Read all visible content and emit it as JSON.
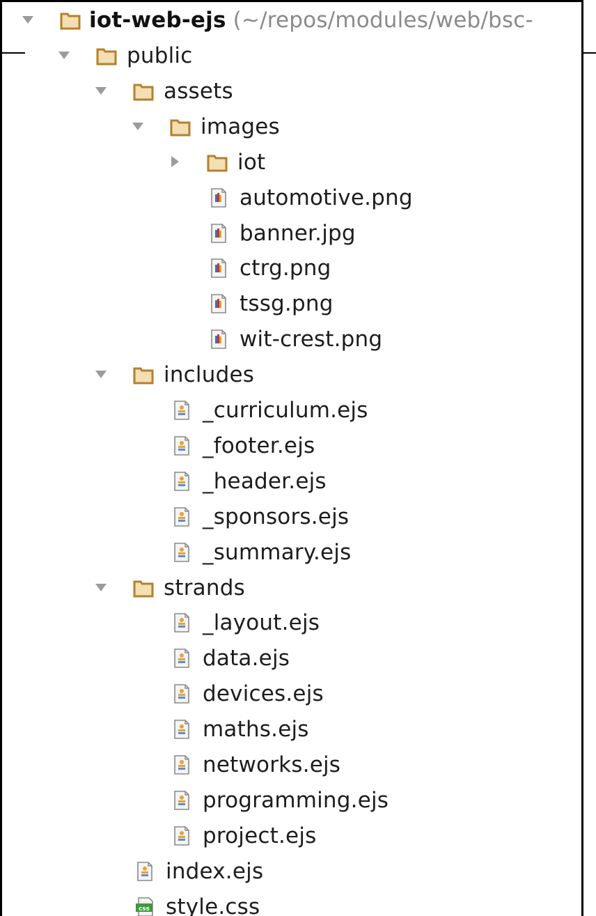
{
  "tree": {
    "root": {
      "name": "iot-web-ejs",
      "path": "(~/repos/modules/web/bsc-",
      "expanded": true,
      "icon": "folder-icon"
    },
    "items": [
      {
        "label": "public",
        "depth": 1,
        "type": "folder",
        "expanded": true
      },
      {
        "label": "assets",
        "depth": 2,
        "type": "folder",
        "expanded": true
      },
      {
        "label": "images",
        "depth": 3,
        "type": "folder",
        "expanded": true
      },
      {
        "label": "iot",
        "depth": 4,
        "type": "folder",
        "expanded": false
      },
      {
        "label": "automotive.png",
        "depth": 4,
        "type": "image"
      },
      {
        "label": "banner.jpg",
        "depth": 4,
        "type": "image"
      },
      {
        "label": "ctrg.png",
        "depth": 4,
        "type": "image"
      },
      {
        "label": "tssg.png",
        "depth": 4,
        "type": "image"
      },
      {
        "label": "wit-crest.png",
        "depth": 4,
        "type": "image"
      },
      {
        "label": "includes",
        "depth": 2,
        "type": "folder",
        "expanded": true
      },
      {
        "label": "_curriculum.ejs",
        "depth": 3,
        "type": "ejs"
      },
      {
        "label": "_footer.ejs",
        "depth": 3,
        "type": "ejs"
      },
      {
        "label": "_header.ejs",
        "depth": 3,
        "type": "ejs"
      },
      {
        "label": "_sponsors.ejs",
        "depth": 3,
        "type": "ejs"
      },
      {
        "label": "_summary.ejs",
        "depth": 3,
        "type": "ejs"
      },
      {
        "label": "strands",
        "depth": 2,
        "type": "folder",
        "expanded": true
      },
      {
        "label": "_layout.ejs",
        "depth": 3,
        "type": "ejs"
      },
      {
        "label": "data.ejs",
        "depth": 3,
        "type": "ejs"
      },
      {
        "label": "devices.ejs",
        "depth": 3,
        "type": "ejs"
      },
      {
        "label": "maths.ejs",
        "depth": 3,
        "type": "ejs"
      },
      {
        "label": "networks.ejs",
        "depth": 3,
        "type": "ejs"
      },
      {
        "label": "programming.ejs",
        "depth": 3,
        "type": "ejs"
      },
      {
        "label": "project.ejs",
        "depth": 3,
        "type": "ejs"
      },
      {
        "label": "index.ejs",
        "depth": 2,
        "type": "ejs"
      },
      {
        "label": "style.css",
        "depth": 2,
        "type": "css"
      }
    ]
  },
  "colors": {
    "folder_fill": "#f2dfb3",
    "folder_stroke": "#b57f2c",
    "arrow": "#9b9b9b",
    "image_icon_accent": "#c0392b",
    "ejs_icon_accent": "#e3a33b",
    "css_icon_accent": "#3a9a3a"
  },
  "icons": {
    "folder": "folder-icon",
    "image": "image-file-icon",
    "ejs": "ejs-file-icon",
    "css": "css-file-icon",
    "expanded": "triangle-down-icon",
    "collapsed": "triangle-right-icon"
  },
  "css_badge": "css"
}
